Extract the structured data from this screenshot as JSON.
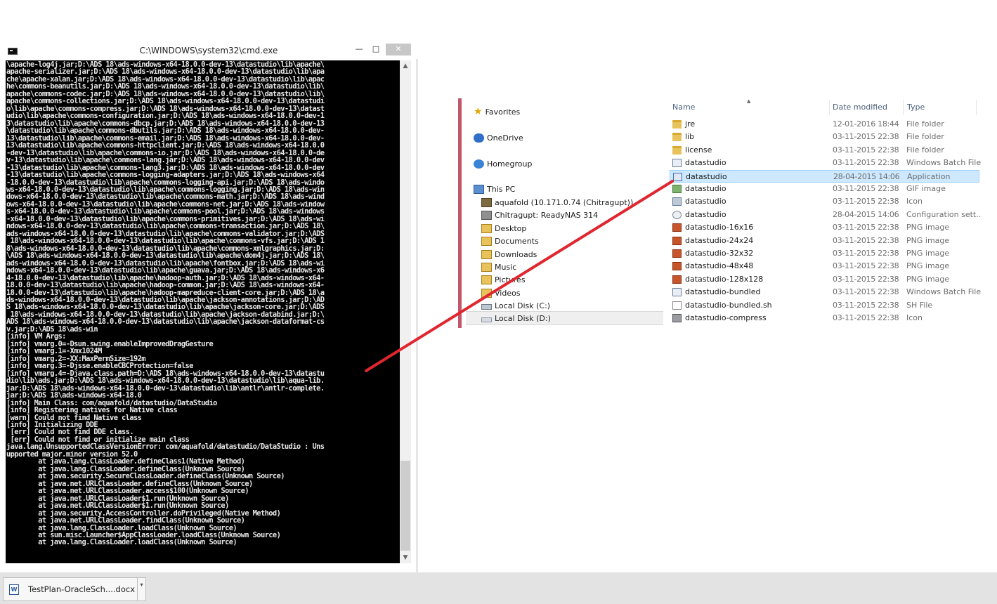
{
  "cmd": {
    "title": "C:\\WINDOWS\\system32\\cmd.exe",
    "minimize": "—",
    "maximize": "□",
    "close": "✕",
    "lines": [
      "\\apache-log4j.jar;D:\\ADS 18\\ads-windows-x64-18.0.0-dev-13\\datastudio\\lib\\apache\\",
      "apache-serializer.jar;D:\\ADS 18\\ads-windows-x64-18.0.0-dev-13\\datastudio\\lib\\apa",
      "che\\apache-xalan.jar;D:\\ADS 18\\ads-windows-x64-18.0.0-dev-13\\datastudio\\lib\\apac",
      "he\\commons-beanutils.jar;D:\\ADS 18\\ads-windows-x64-18.0.0-dev-13\\datastudio\\lib\\",
      "apache\\commons-codec.jar;D:\\ADS 18\\ads-windows-x64-18.0.0-dev-13\\datastudio\\lib\\",
      "apache\\commons-collections.jar;D:\\ADS 18\\ads-windows-x64-18.0.0-dev-13\\datastudi",
      "o\\lib\\apache\\commons-compress.jar;D:\\ADS 18\\ads-windows-x64-18.0.0-dev-13\\datast",
      "udio\\lib\\apache\\commons-configuration.jar;D:\\ADS 18\\ads-windows-x64-18.0.0-dev-1",
      "3\\datastudio\\lib\\apache\\commons-dbcp.jar;D:\\ADS 18\\ads-windows-x64-18.0.0-dev-13",
      "\\datastudio\\lib\\apache\\commons-dbutils.jar;D:\\ADS 18\\ads-windows-x64-18.0.0-dev-",
      "13\\datastudio\\lib\\apache\\commons-email.jar;D:\\ADS 18\\ads-windows-x64-18.0.0-dev-",
      "13\\datastudio\\lib\\apache\\commons-httpclient.jar;D:\\ADS 18\\ads-windows-x64-18.0.0",
      "-dev-13\\datastudio\\lib\\apache\\commons-io.jar;D:\\ADS 18\\ads-windows-x64-18.0.0-de",
      "v-13\\datastudio\\lib\\apache\\commons-lang.jar;D:\\ADS 18\\ads-windows-x64-18.0.0-dev",
      "-13\\datastudio\\lib\\apache\\commons-lang3.jar;D:\\ADS 18\\ads-windows-x64-18.0.0-dev",
      "-13\\datastudio\\lib\\apache\\commons-logging-adapters.jar;D:\\ADS 18\\ads-windows-x64",
      "-18.0.0-dev-13\\datastudio\\lib\\apache\\commons-logging-api.jar;D:\\ADS 18\\ads-windo",
      "ws-x64-18.0.0-dev-13\\datastudio\\lib\\apache\\commons-logging.jar;D:\\ADS 18\\ads-win",
      "dows-x64-18.0.0-dev-13\\datastudio\\lib\\apache\\commons-math.jar;D:\\ADS 18\\ads-wind",
      "ows-x64-18.0.0-dev-13\\datastudio\\lib\\apache\\commons-net.jar;D:\\ADS 18\\ads-window",
      "s-x64-18.0.0-dev-13\\datastudio\\lib\\apache\\commons-pool.jar;D:\\ADS 18\\ads-windows",
      "-x64-18.0.0-dev-13\\datastudio\\lib\\apache\\commons-primitives.jar;D:\\ADS 18\\ads-wi",
      "ndows-x64-18.0.0-dev-13\\datastudio\\lib\\apache\\commons-transaction.jar;D:\\ADS 18\\",
      "ads-windows-x64-18.0.0-dev-13\\datastudio\\lib\\apache\\commons-validator.jar;D:\\ADS",
      " 18\\ads-windows-x64-18.0.0-dev-13\\datastudio\\lib\\apache\\commons-vfs.jar;D:\\ADS 1",
      "8\\ads-windows-x64-18.0.0-dev-13\\datastudio\\lib\\apache\\commons-xmlgraphics.jar;D:",
      "\\ADS 18\\ads-windows-x64-18.0.0-dev-13\\datastudio\\lib\\apache\\dom4j.jar;D:\\ADS 18\\",
      "ads-windows-x64-18.0.0-dev-13\\datastudio\\lib\\apache\\fontbox.jar;D:\\ADS 18\\ads-wi",
      "ndows-x64-18.0.0-dev-13\\datastudio\\lib\\apache\\guava.jar;D:\\ADS 18\\ads-windows-x6",
      "4-18.0.0-dev-13\\datastudio\\lib\\apache\\hadoop-auth.jar;D:\\ADS 18\\ads-windows-x64-",
      "18.0.0-dev-13\\datastudio\\lib\\apache\\hadoop-common.jar;D:\\ADS 18\\ads-windows-x64-",
      "18.0.0-dev-13\\datastudio\\lib\\apache\\hadoop-mapreduce-client-core.jar;D:\\ADS 18\\a",
      "ds-windows-x64-18.0.0-dev-13\\datastudio\\lib\\apache\\jackson-annotations.jar;D:\\AD",
      "S 18\\ads-windows-x64-18.0.0-dev-13\\datastudio\\lib\\apache\\jackson-core.jar;D:\\ADS",
      " 18\\ads-windows-x64-18.0.0-dev-13\\datastudio\\lib\\apache\\jackson-databind.jar;D:\\",
      "ADS 18\\ads-windows-x64-18.0.0-dev-13\\datastudio\\lib\\apache\\jackson-dataformat-cs",
      "v.jar;D:\\ADS 18\\ads-win",
      "[info] VM Args:",
      "[info] vmarg.0=-Dsun.swing.enableImprovedDragGesture",
      "[info] vmarg.1=-Xmx1024M",
      "[info] vmarg.2=-XX:MaxPermSize=192m",
      "[info] vmarg.3=-Djsse.enableCBCProtection=false",
      "[info] vmarg.4=-Djava.class.path=D:\\ADS 18\\ads-windows-x64-18.0.0-dev-13\\datastu",
      "dio\\lib\\ads.jar;D:\\ADS 18\\ads-windows-x64-18.0.0-dev-13\\datastudio\\lib\\aqua-lib.",
      "jar;D:\\ADS 18\\ads-windows-x64-18.0.0-dev-13\\datastudio\\lib\\antlr\\antlr-complete.",
      "jar;D:\\ADS 18\\ads-windows-x64-18.0",
      "[info] Main Class: com/aquafold/datastudio/DataStudio",
      "[info] Registering natives for Native class",
      "[warn] Could not find Native class",
      "[info] Initializing DDE",
      " [err] Could not find DDE class.",
      " [err] Could not find or initialize main class",
      "java.lang.UnsupportedClassVersionError: com/aquafold/datastudio/DataStudio : Uns",
      "upported major.minor version 52.0",
      "        at java.lang.ClassLoader.defineClass1(Native Method)",
      "        at java.lang.ClassLoader.defineClass(Unknown Source)",
      "        at java.security.SecureClassLoader.defineClass(Unknown Source)",
      "        at java.net.URLClassLoader.defineClass(Unknown Source)",
      "        at java.net.URLClassLoader.access$100(Unknown Source)",
      "        at java.net.URLClassLoader$1.run(Unknown Source)",
      "        at java.net.URLClassLoader$1.run(Unknown Source)",
      "        at java.security.AccessController.doPrivileged(Native Method)",
      "        at java.net.URLClassLoader.findClass(Unknown Source)",
      "        at java.lang.ClassLoader.loadClass(Unknown Source)",
      "        at sun.misc.Launcher$AppClassLoader.loadClass(Unknown Source)",
      "        at java.lang.ClassLoader.loadClass(Unknown Source)"
    ]
  },
  "explorer": {
    "nav": [
      {
        "label": "Favorites",
        "icon": "star-icon"
      },
      {
        "label": "OneDrive",
        "icon": "cloud-icon"
      },
      {
        "label": "Homegroup",
        "icon": "homegroup-icon"
      },
      {
        "label": "This PC",
        "icon": "computer-icon"
      },
      {
        "label": "aquafold (10.171.0.74 (Chitragupt))",
        "icon": "network-drive-icon"
      },
      {
        "label": "Chitragupt: ReadyNAS 314",
        "icon": "nas-icon"
      },
      {
        "label": "Desktop",
        "icon": "folder-icon"
      },
      {
        "label": "Documents",
        "icon": "folder-icon"
      },
      {
        "label": "Downloads",
        "icon": "folder-icon"
      },
      {
        "label": "Music",
        "icon": "folder-icon"
      },
      {
        "label": "Pictures",
        "icon": "folder-icon"
      },
      {
        "label": "Videos",
        "icon": "folder-icon"
      },
      {
        "label": "Local Disk (C:)",
        "icon": "drive-icon"
      },
      {
        "label": "Local Disk (D:)",
        "icon": "drive-icon"
      }
    ],
    "columns": {
      "name": "Name",
      "date": "Date modified",
      "type": "Type"
    },
    "files": [
      {
        "name": "jre",
        "date": "12-01-2016 18:44",
        "type": "File folder",
        "icon": "folder-icon"
      },
      {
        "name": "lib",
        "date": "03-11-2015 22:38",
        "type": "File folder",
        "icon": "folder-icon"
      },
      {
        "name": "license",
        "date": "03-11-2015 22:38",
        "type": "File folder",
        "icon": "folder-icon"
      },
      {
        "name": "datastudio",
        "date": "03-11-2015 22:38",
        "type": "Windows Batch File",
        "icon": "batch-file-icon"
      },
      {
        "name": "datastudio",
        "date": "28-04-2015 14:06",
        "type": "Application",
        "icon": "application-icon"
      },
      {
        "name": "datastudio",
        "date": "03-11-2015 22:38",
        "type": "GIF image",
        "icon": "gif-image-icon"
      },
      {
        "name": "datastudio",
        "date": "03-11-2015 22:38",
        "type": "Icon",
        "icon": "icon-file-icon"
      },
      {
        "name": "datastudio",
        "date": "28-04-2015 14:06",
        "type": "Configuration sett...",
        "icon": "config-file-icon"
      },
      {
        "name": "datastudio-16x16",
        "date": "03-11-2015 22:38",
        "type": "PNG image",
        "icon": "png-image-icon"
      },
      {
        "name": "datastudio-24x24",
        "date": "03-11-2015 22:38",
        "type": "PNG image",
        "icon": "png-image-icon"
      },
      {
        "name": "datastudio-32x32",
        "date": "03-11-2015 22:38",
        "type": "PNG image",
        "icon": "png-image-icon"
      },
      {
        "name": "datastudio-48x48",
        "date": "03-11-2015 22:38",
        "type": "PNG image",
        "icon": "png-image-icon"
      },
      {
        "name": "datastudio-128x128",
        "date": "03-11-2015 22:38",
        "type": "PNG image",
        "icon": "png-image-icon"
      },
      {
        "name": "datastudio-bundled",
        "date": "03-11-2015 22:38",
        "type": "Windows Batch File",
        "icon": "batch-file-icon"
      },
      {
        "name": "datastudio-bundled.sh",
        "date": "03-11-2015 22:38",
        "type": "SH File",
        "icon": "sh-file-icon"
      },
      {
        "name": "datastudio-compress",
        "date": "03-11-2015 22:38",
        "type": "Icon",
        "icon": "icon-file-icon"
      }
    ],
    "selected_file_index": 4,
    "selected_nav_index": 13
  },
  "taskbar": {
    "item_label": "TestPlan-OracleSch....docx",
    "item_icon": "word-document-icon",
    "dropdown": "▾"
  },
  "annotation": {
    "color": "#e0262f"
  }
}
